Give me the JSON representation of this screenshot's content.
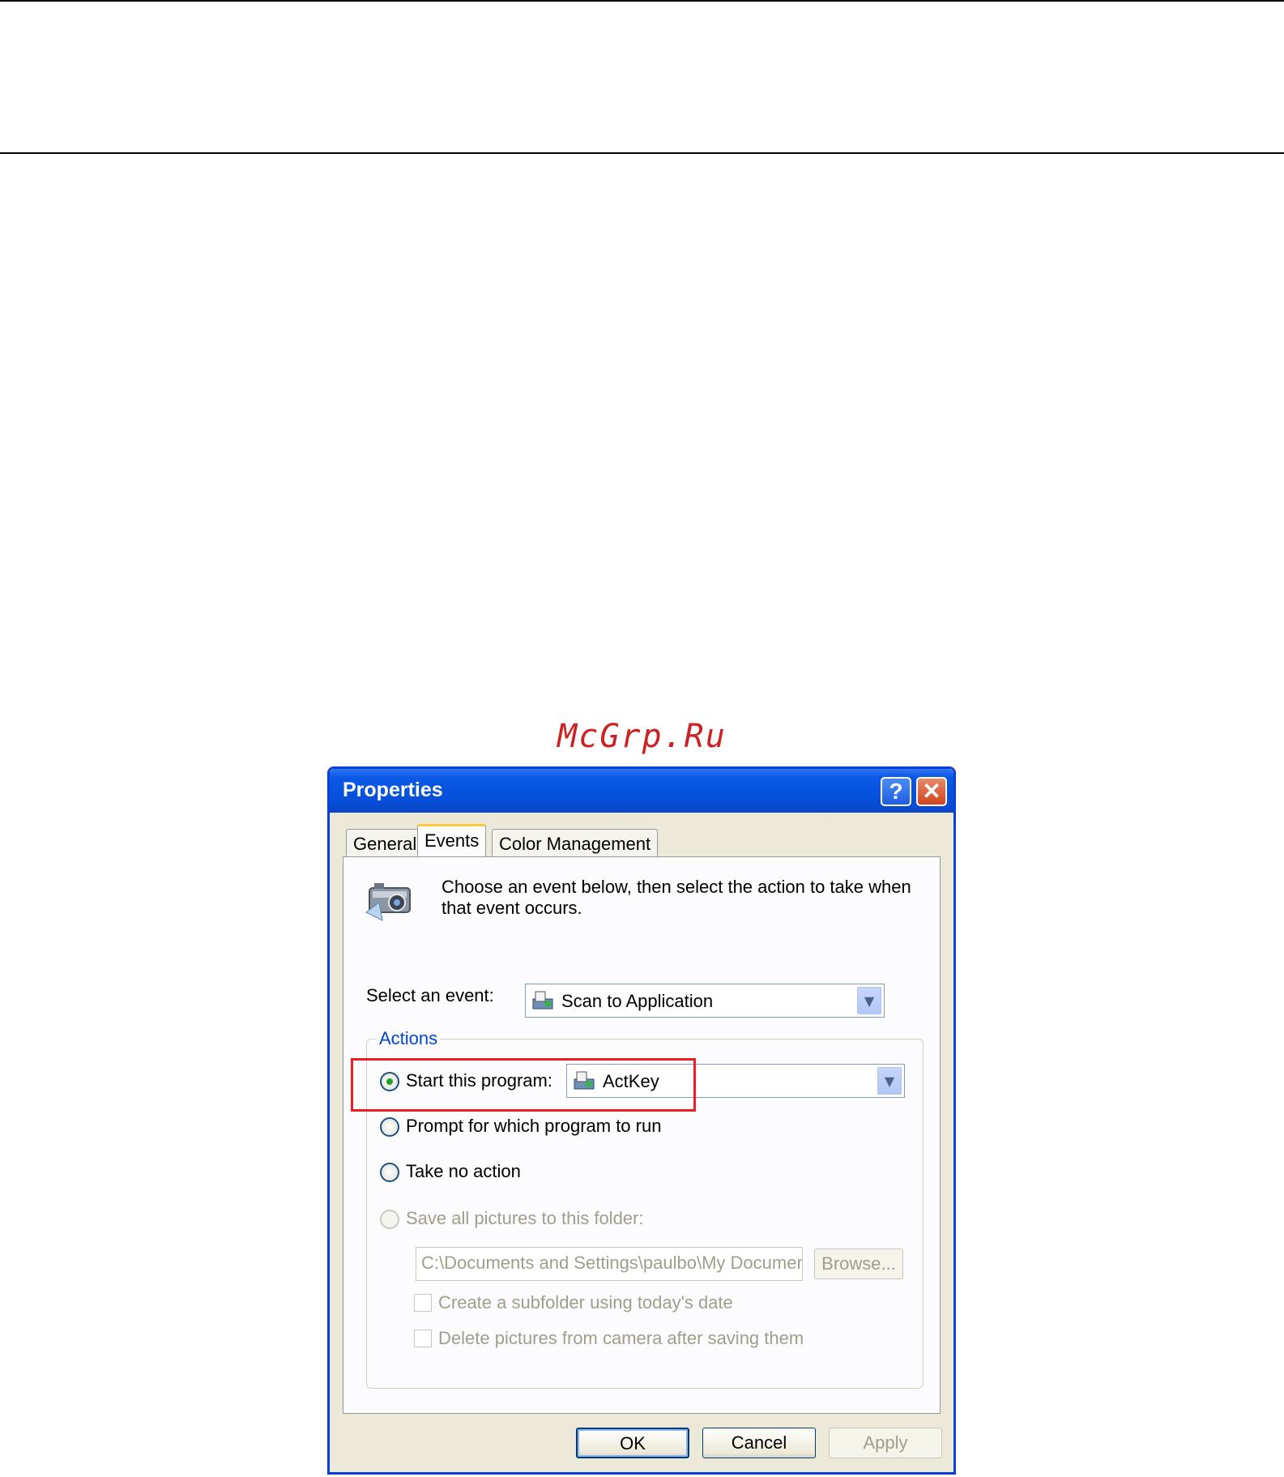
{
  "watermark": "McGrp.Ru",
  "dialog": {
    "title": "Properties",
    "help_button": "?",
    "close_button": "✕",
    "tabs": [
      "General",
      "Events",
      "Color Management"
    ],
    "active_tab": "Events",
    "description": "Choose an event below, then select the action to take when that event occurs.",
    "select_event_label": "Select an event:",
    "select_event_value": "Scan to Application",
    "actions": {
      "group_label": "Actions",
      "start_program_label": "Start this program:",
      "start_program_value": "ActKey",
      "prompt_label": "Prompt for which program to run",
      "no_action_label": "Take no action",
      "save_pictures_label": "Save all pictures to this folder:",
      "folder_path": "C:\\Documents and Settings\\paulbo\\My Document",
      "browse_button": "Browse...",
      "subfolder_label": "Create a subfolder using today's date",
      "delete_label": "Delete pictures from camera after saving them",
      "selected_option": "start_program"
    },
    "buttons": {
      "ok": "OK",
      "cancel": "Cancel",
      "apply": "Apply"
    }
  },
  "icons": {
    "title_help": "question-icon",
    "title_close": "close-icon",
    "event_header": "camera-icon",
    "combo_item": "scanner-icon",
    "dropdown": "chevron-down-icon"
  },
  "colors": {
    "titlebar": "#0a58e6",
    "highlight": "#ee1c24",
    "group_label": "#0046d5",
    "watermark": "#cc2222"
  }
}
